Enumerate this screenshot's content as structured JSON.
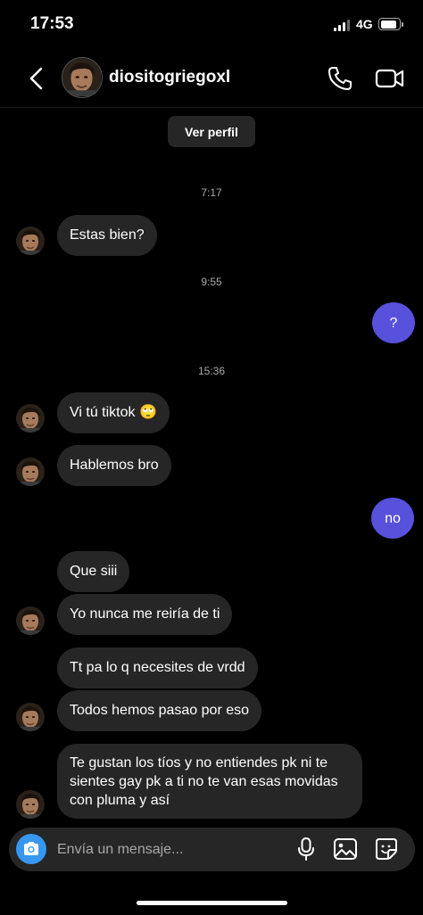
{
  "status_bar": {
    "time": "17:53",
    "network": "4G",
    "battery_level": 0.9
  },
  "header": {
    "username": "diositogriegoxl"
  },
  "profile_button": {
    "label": "Ver perfil"
  },
  "timestamps": [
    "7:17",
    "9:55",
    "15:36"
  ],
  "messages": [
    {
      "from": "them",
      "text": "Estas bien?"
    },
    {
      "from": "me",
      "text": "?"
    },
    {
      "from": "them",
      "text": "Vi tú tiktok 🙄"
    },
    {
      "from": "them",
      "text": "Hablemos bro"
    },
    {
      "from": "me",
      "text": "no"
    },
    {
      "from": "them",
      "text": "Que siii"
    },
    {
      "from": "them",
      "text": "Yo nunca me reiría de ti"
    },
    {
      "from": "them",
      "text": "Tt pa lo q necesites de vrdd"
    },
    {
      "from": "them",
      "text": "Todos hemos pasao por eso"
    },
    {
      "from": "them",
      "text": "Te gustan los tíos y no entiendes pk ni te sientes gay pk a ti no te van esas movidas con pluma y así"
    }
  ],
  "composer": {
    "placeholder": "Envía un mensaje..."
  },
  "colors": {
    "background": "#000000",
    "their_bubble": "#262626",
    "my_bubble": "#5851db",
    "camera_button": "#3797f0"
  }
}
